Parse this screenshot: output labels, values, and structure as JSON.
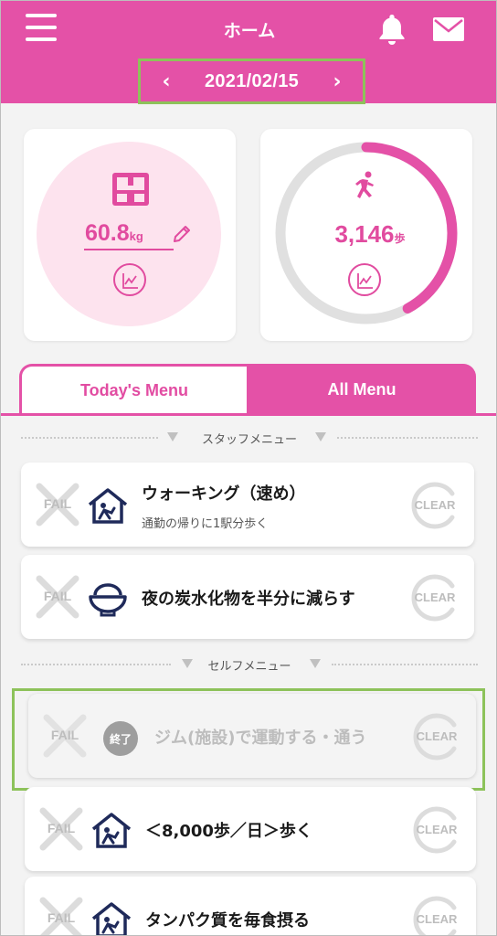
{
  "header": {
    "title": "ホーム",
    "date": "2021/02/15",
    "prev_arrow": "‹",
    "next_arrow": "›"
  },
  "weight_card": {
    "value": "60.8",
    "unit": "kg"
  },
  "steps_card": {
    "value": "3,146",
    "unit": "歩",
    "progress": 0.42
  },
  "tabs": {
    "today": "Today's Menu",
    "all": "All Menu",
    "active": "all"
  },
  "sections": {
    "staff": "スタッフメニュー",
    "self": "セルフメニュー"
  },
  "labels": {
    "fail": "FAIL",
    "clear": "CLEAR",
    "done": "終了"
  },
  "items": [
    {
      "title": "ウォーキング（速め）",
      "subtitle": "通勤の帰りに1駅分歩く",
      "icon": "home-exercise-icon"
    },
    {
      "title": "夜の炭水化物を半分に減らす",
      "icon": "rice-bowl-icon"
    },
    {
      "title": "ジム(施設)で運動する・通う",
      "status": "終了"
    },
    {
      "title": "＜8,000歩／日＞歩く",
      "icon": "home-exercise-icon"
    },
    {
      "title": "タンパク質を毎食摂る",
      "icon": "home-exercise-icon"
    }
  ],
  "colors": {
    "brand_pink": "#e451a7",
    "light_pink": "#fde3ee",
    "highlight_green": "#8dc25a"
  }
}
